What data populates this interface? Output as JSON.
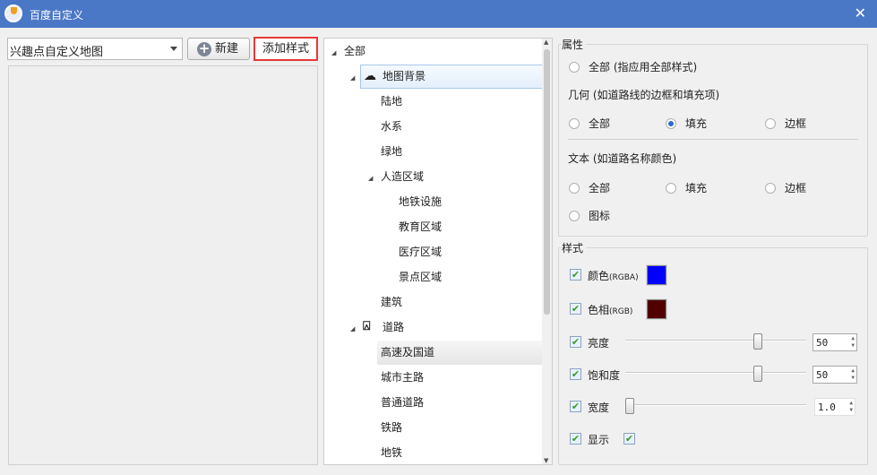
{
  "window": {
    "title": "百度自定义",
    "close": "✕"
  },
  "toolbar": {
    "map_select": "兴趣点自定义地图",
    "new_label": "新建",
    "new_icon": "plus-circle-icon",
    "add_style_label": "添加样式"
  },
  "tree": {
    "root": "全部",
    "map_bg": "地图背景",
    "land": "陆地",
    "water": "水系",
    "green": "绿地",
    "manmade": "人造区域",
    "subway_fac": "地铁设施",
    "edu": "教育区域",
    "medical": "医疗区域",
    "scenic": "景点区域",
    "building": "建筑",
    "road": "道路",
    "highway": "高速及国道",
    "main_road": "城市主路",
    "normal_road": "普通道路",
    "railway": "铁路",
    "subway": "地铁"
  },
  "properties": {
    "title": "属性",
    "all_apply": "全部 (指应用全部样式)",
    "geometry_title": "几何 (如道路线的边框和填充项)",
    "geo_all": "全部",
    "geo_fill": "填充",
    "geo_border": "边框",
    "geo_selected": "填充",
    "text_title": "文本 (如道路名称颜色)",
    "text_all": "全部",
    "text_fill": "填充",
    "text_border": "边框",
    "text_icon": "图标"
  },
  "style": {
    "title": "样式",
    "color_label": "颜色",
    "color_suffix": "(RGBA)",
    "color_value": "#0000ff",
    "hue_label": "色相",
    "hue_suffix": "(RGB)",
    "hue_value": "#500000",
    "brightness_label": "亮度",
    "brightness": "50",
    "saturation_label": "饱和度",
    "saturation": "50",
    "width_label": "宽度",
    "width": "1.0",
    "visible_label": "显示",
    "check": "✔"
  }
}
